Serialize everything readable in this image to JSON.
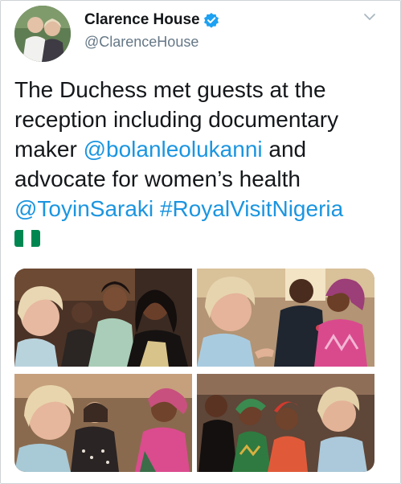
{
  "tweet": {
    "display_name": "Clarence House",
    "handle": "@ClarenceHouse",
    "lines": [
      {
        "plain": "The Duchess met guests at the"
      },
      {
        "plain": "reception including documentary"
      },
      {
        "plain": "maker ",
        "link": "@bolanleolukanni",
        "after": " and"
      },
      {
        "plain": "advocate for women’s health"
      },
      {
        "link": "@ToyinSaraki",
        "between": " ",
        "link2": "#RoyalVisitNigeria"
      }
    ]
  },
  "icons": {
    "verified": "verified-badge-icon",
    "menu": "chevron-down-icon",
    "flag": "nigeria-flag-emoji"
  },
  "colors": {
    "link": "#1b95e0",
    "verified": "#1da1f2",
    "text": "#14171a",
    "secondary": "#657786",
    "flag_green": "#008751"
  },
  "media": {
    "count": 4
  }
}
